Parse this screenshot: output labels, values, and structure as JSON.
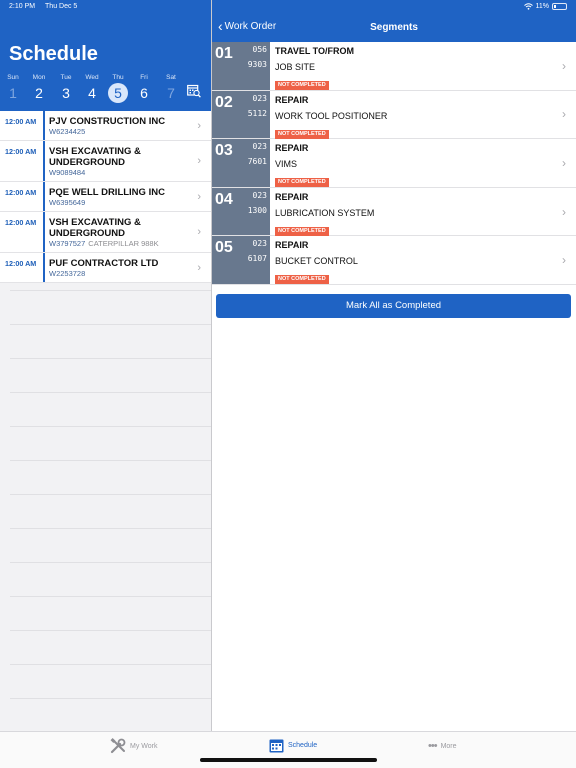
{
  "status_bar": {
    "time": "2:10 PM",
    "date": "Thu Dec 5",
    "battery": "11%"
  },
  "schedule": {
    "title": "Schedule",
    "week": [
      {
        "name": "Sun",
        "num": "1",
        "dim": true
      },
      {
        "name": "Mon",
        "num": "2",
        "dim": false
      },
      {
        "name": "Tue",
        "num": "3",
        "dim": false
      },
      {
        "name": "Wed",
        "num": "4",
        "dim": false
      },
      {
        "name": "Thu",
        "num": "5",
        "selected": true
      },
      {
        "name": "Fri",
        "num": "6",
        "dim": false
      },
      {
        "name": "Sat",
        "num": "7",
        "dim": true
      }
    ],
    "items": [
      {
        "time": "12:00 AM",
        "name": "PJV CONSTRUCTION INC",
        "wo": "W6234425",
        "extra": ""
      },
      {
        "time": "12:00 AM",
        "name": "VSH EXCAVATING & UNDERGROUND",
        "wo": "W9089484",
        "extra": ""
      },
      {
        "time": "12:00 AM",
        "name": "PQE WELL DRILLING INC",
        "wo": "W6395649",
        "extra": ""
      },
      {
        "time": "12:00 AM",
        "name": "VSH EXCAVATING & UNDERGROUND",
        "wo": "W3797527",
        "extra": "CATERPILLAR 988K"
      },
      {
        "time": "12:00 AM",
        "name": "PUF CONTRACTOR LTD",
        "wo": "W2253728",
        "extra": ""
      }
    ]
  },
  "segments_header": {
    "back_label": "Work Order",
    "title": "Segments"
  },
  "segments": [
    {
      "num": "01",
      "code1": "056",
      "code2": "9303",
      "line1": "TRAVEL TO/FROM",
      "line2": "JOB SITE",
      "status": "NOT COMPLETED"
    },
    {
      "num": "02",
      "code1": "023",
      "code2": "5112",
      "line1": "REPAIR",
      "line2": "WORK TOOL POSITIONER",
      "status": "NOT COMPLETED"
    },
    {
      "num": "03",
      "code1": "023",
      "code2": "7601",
      "line1": "REPAIR",
      "line2": "VIMS",
      "status": "NOT COMPLETED"
    },
    {
      "num": "04",
      "code1": "023",
      "code2": "1300",
      "line1": "REPAIR",
      "line2": "LUBRICATION SYSTEM",
      "status": "NOT COMPLETED"
    },
    {
      "num": "05",
      "code1": "023",
      "code2": "6107",
      "line1": "REPAIR",
      "line2": "BUCKET CONTROL",
      "status": "NOT COMPLETED"
    }
  ],
  "actions": {
    "mark_all": "Mark All as Completed"
  },
  "tabs": [
    {
      "label": "My Work",
      "icon": "tools-icon",
      "active": false
    },
    {
      "label": "Schedule",
      "icon": "calendar-icon",
      "active": true
    },
    {
      "label": "More",
      "icon": "more-dots-icon",
      "active": false
    }
  ],
  "colors": {
    "primary": "#1f63c4",
    "segment_number_bg": "#68788e",
    "not_completed": "#ee6146"
  }
}
